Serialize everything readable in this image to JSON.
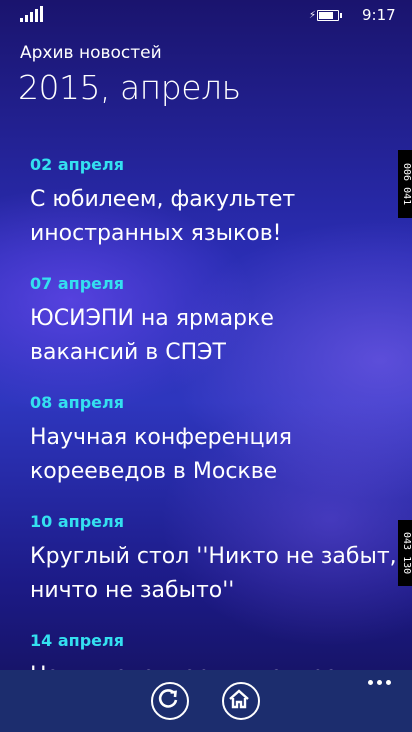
{
  "status_bar": {
    "time": "9:17",
    "signal_bars": 5,
    "battery_level_fraction": 0.85,
    "battery_charging": true
  },
  "header": {
    "app_title": "Архив новостей",
    "page_title": "2015, апрель"
  },
  "news": [
    {
      "date": "02 апреля",
      "title": "С юбилеем, факультет\nиностранных языков!"
    },
    {
      "date": "07 апреля",
      "title": "ЮСИЭПИ на ярмарке\nвакансий в СПЭТ"
    },
    {
      "date": "08 апреля",
      "title": "Научная конференция\nкорееведов в Москве"
    },
    {
      "date": "10 апреля",
      "title": "Круглый стол ''Никто не забыт,\nничто не забыто''"
    },
    {
      "date": "14 апреля",
      "title": "Наши волонтеры в центре"
    }
  ],
  "side_badges": [
    "006 041",
    "043 130"
  ],
  "app_bar": {
    "buttons": [
      {
        "name": "refresh",
        "icon": "refresh-icon"
      },
      {
        "name": "home",
        "icon": "home-icon"
      }
    ],
    "more_icon": "more-dots-icon"
  },
  "colors": {
    "accent_date": "#34e0f0",
    "app_bar_bg": "#1c2d6e"
  }
}
